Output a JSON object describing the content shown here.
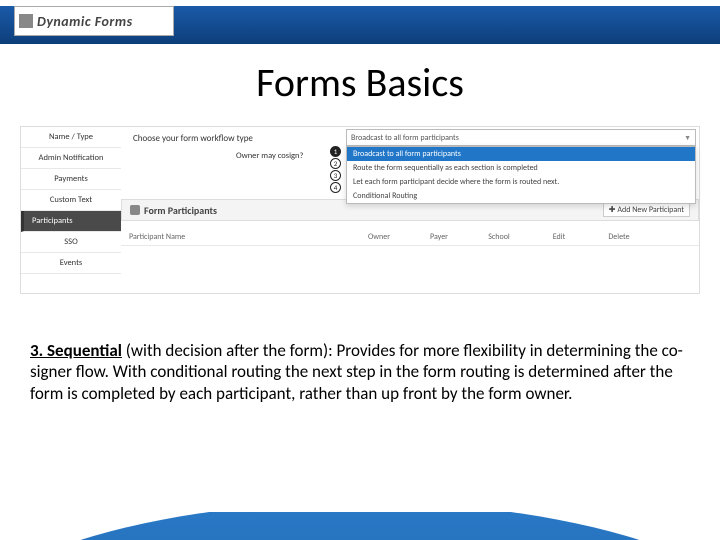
{
  "logo": {
    "text": "Dynamic Forms"
  },
  "title": "Forms Basics",
  "sidebar": {
    "items": [
      {
        "label": "Name / Type"
      },
      {
        "label": "Admin Notification"
      },
      {
        "label": "Payments"
      },
      {
        "label": "Custom Text"
      },
      {
        "label": "Participants"
      },
      {
        "label": "SSO"
      },
      {
        "label": "Events"
      }
    ]
  },
  "workflow": {
    "heading": "Choose your form workflow type",
    "selected": "Broadcast to all form participants",
    "cosign_label": "Owner may cosign?",
    "options": [
      "Broadcast to all form participants",
      "Route the form sequentially as each section is completed",
      "Let each form participant decide where the form is routed next.",
      "Conditional Routing"
    ],
    "numbers": [
      "1",
      "2",
      "3",
      "4"
    ]
  },
  "participants_panel": {
    "title": "Form Participants",
    "add_button": "Add New Participant",
    "columns": [
      "Participant Name",
      "Owner",
      "Payer",
      "School",
      "Edit",
      "Delete"
    ]
  },
  "description": {
    "lead": "3. Sequential",
    "rest": " (with decision after the form): Provides for more flexibility in determining the co-signer flow. With conditional routing the next step in the form routing is determined after the form is completed by each participant, rather than up front by the form owner."
  }
}
